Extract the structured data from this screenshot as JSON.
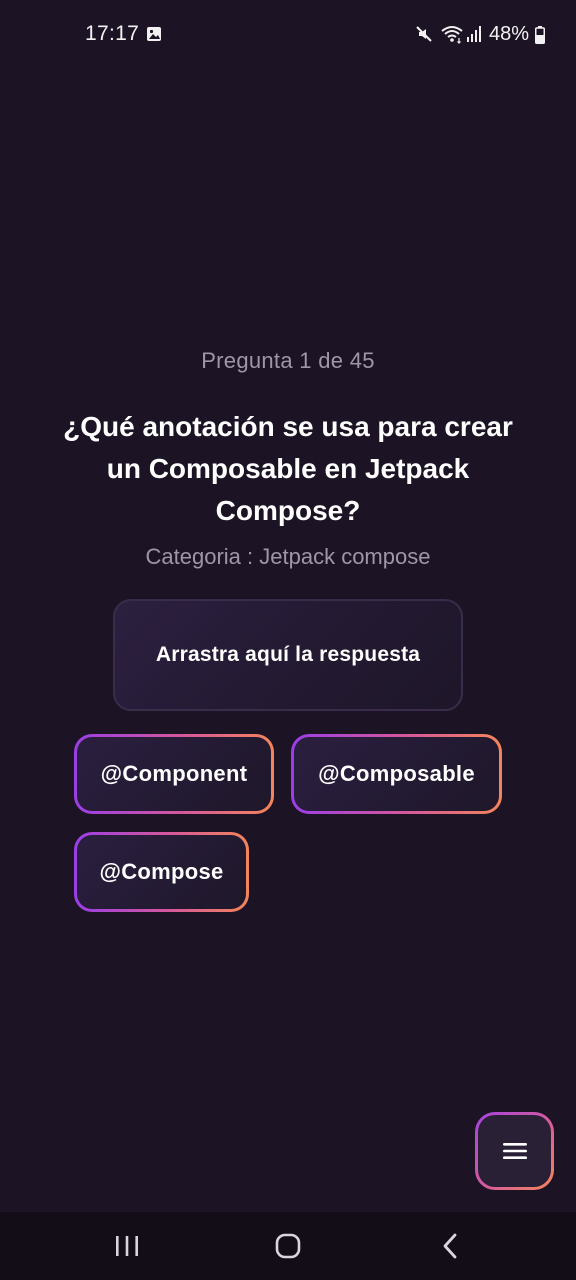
{
  "status_bar": {
    "time": "17:17",
    "battery": "48%",
    "icons": [
      "gallery-icon",
      "mute-icon",
      "wifi-icon",
      "signal-icon",
      "battery-icon"
    ]
  },
  "quiz": {
    "progress": "Pregunta 1 de 45",
    "question": "¿Qué anotación se usa para crear un Composable en Jetpack Compose?",
    "category": "Categoria : Jetpack compose",
    "drop_zone_label": "Arrastra aquí la respuesta",
    "options": [
      {
        "label": "@Component"
      },
      {
        "label": "@Composable"
      },
      {
        "label": "@Compose"
      }
    ]
  },
  "fab": {
    "icon": "menu-icon"
  },
  "nav_bar": {
    "icons": [
      "recents-icon",
      "home-icon",
      "back-icon"
    ]
  },
  "colors": {
    "background": "#1c1424",
    "accent_start": "#9a3ee8",
    "accent_end": "#f4855a",
    "muted_text": "#9e97a6"
  }
}
